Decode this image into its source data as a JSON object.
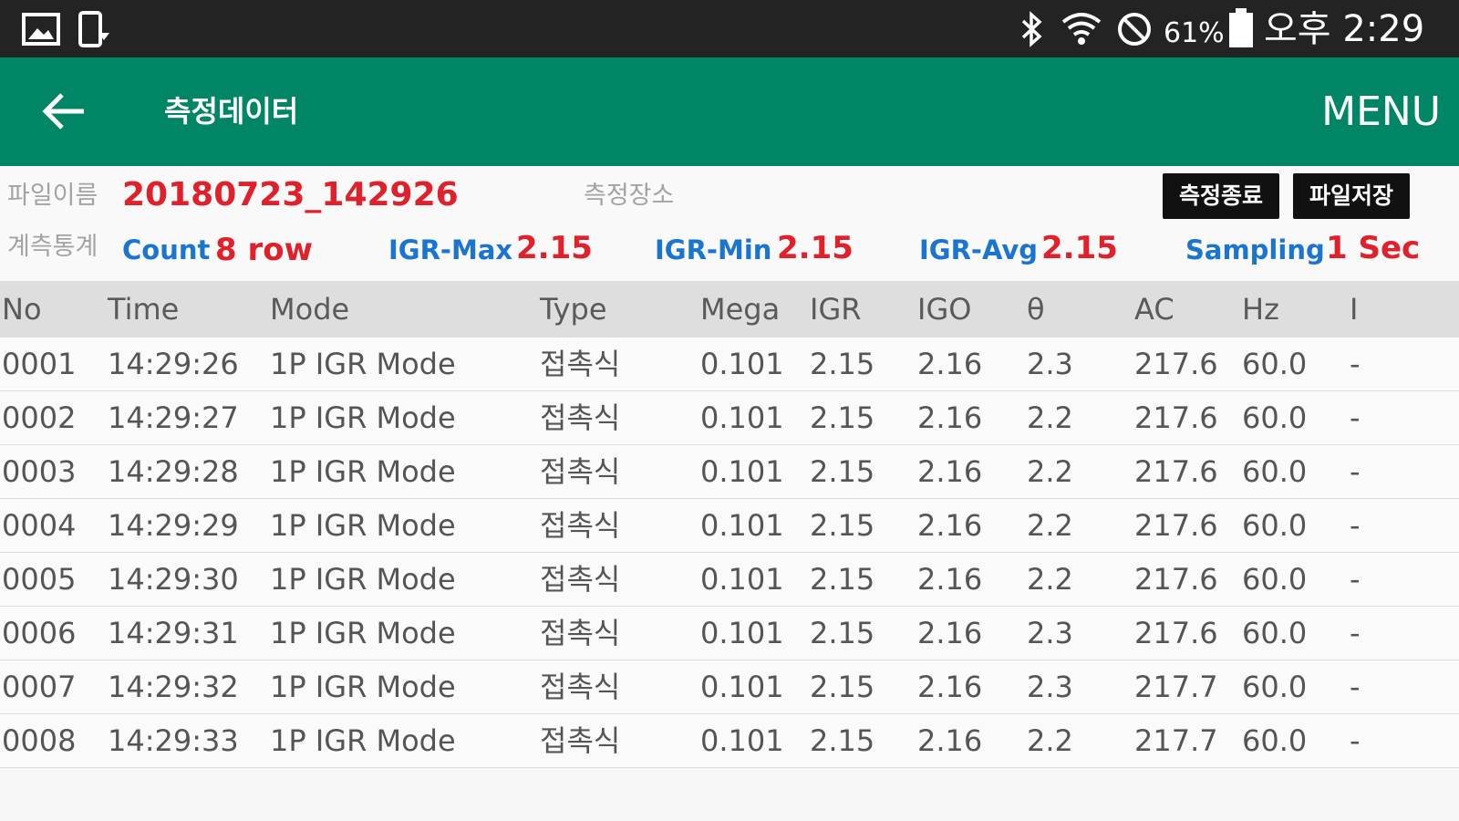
{
  "status_bar": {
    "battery": "61%",
    "time": "오후 2:29",
    "icons": [
      "image-icon",
      "screen-rotate-icon",
      "bluetooth-icon",
      "wifi-icon",
      "do-not-disturb-icon",
      "battery-icon"
    ]
  },
  "app_bar": {
    "title": "측정데이터",
    "menu_label": "MENU"
  },
  "info": {
    "file_label": "파일이름",
    "file_name": "20180723_142926",
    "location_label": "측정장소",
    "stats_label": "계측통계",
    "count_label": "Count",
    "count_value": "8 row",
    "igr_max_label": "IGR-Max",
    "igr_max_value": "2.15",
    "igr_min_label": "IGR-Min",
    "igr_min_value": "2.15",
    "igr_avg_label": "IGR-Avg",
    "igr_avg_value": "2.15",
    "sampling_label": "Sampling",
    "sampling_value": "1 Sec",
    "stop_button": "측정종료",
    "save_button": "파일저장"
  },
  "table": {
    "headers": [
      "No",
      "Time",
      "Mode",
      "Type",
      "Mega",
      "IGR",
      "IGO",
      "θ",
      "AC",
      "Hz",
      "I"
    ],
    "rows": [
      [
        "0001",
        "14:29:26",
        "1P IGR Mode",
        "접촉식",
        "0.101",
        "2.15",
        "2.16",
        "2.3",
        "217.6",
        "60.0",
        "-"
      ],
      [
        "0002",
        "14:29:27",
        "1P IGR Mode",
        "접촉식",
        "0.101",
        "2.15",
        "2.16",
        "2.2",
        "217.6",
        "60.0",
        "-"
      ],
      [
        "0003",
        "14:29:28",
        "1P IGR Mode",
        "접촉식",
        "0.101",
        "2.15",
        "2.16",
        "2.2",
        "217.6",
        "60.0",
        "-"
      ],
      [
        "0004",
        "14:29:29",
        "1P IGR Mode",
        "접촉식",
        "0.101",
        "2.15",
        "2.16",
        "2.2",
        "217.6",
        "60.0",
        "-"
      ],
      [
        "0005",
        "14:29:30",
        "1P IGR Mode",
        "접촉식",
        "0.101",
        "2.15",
        "2.16",
        "2.2",
        "217.6",
        "60.0",
        "-"
      ],
      [
        "0006",
        "14:29:31",
        "1P IGR Mode",
        "접촉식",
        "0.101",
        "2.15",
        "2.16",
        "2.3",
        "217.6",
        "60.0",
        "-"
      ],
      [
        "0007",
        "14:29:32",
        "1P IGR Mode",
        "접촉식",
        "0.101",
        "2.15",
        "2.16",
        "2.3",
        "217.7",
        "60.0",
        "-"
      ],
      [
        "0008",
        "14:29:33",
        "1P IGR Mode",
        "접촉식",
        "0.101",
        "2.15",
        "2.16",
        "2.2",
        "217.7",
        "60.0",
        "-"
      ]
    ]
  },
  "colors": {
    "app_bar": "#008664",
    "status_bar": "#232323",
    "value_red": "#e0202a",
    "label_blue": "#1b75d0"
  }
}
